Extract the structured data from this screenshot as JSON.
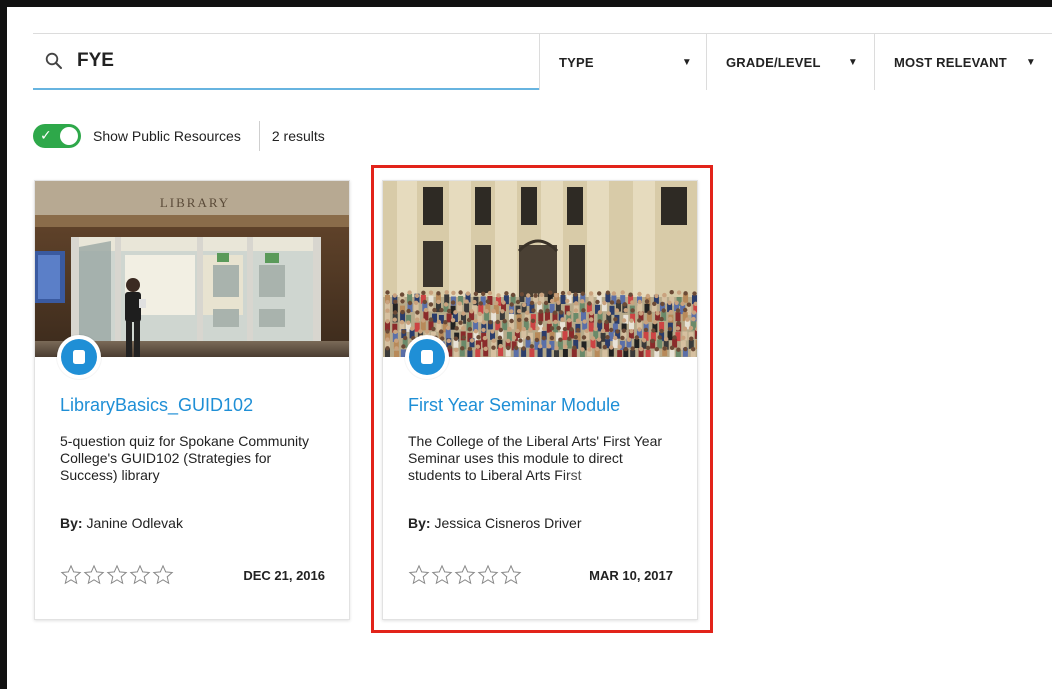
{
  "search": {
    "value": "FYE"
  },
  "filters": {
    "type_label": "TYPE",
    "grade_label": "GRADE/LEVEL",
    "sort_label": "MOST RELEVANT"
  },
  "toggle": {
    "label": "Show Public Resources",
    "on": true
  },
  "results_count": "2 results",
  "cards": [
    {
      "image_sign": "LIBRARY",
      "title": "LibraryBasics_GUID102",
      "description": "5-question quiz for Spokane Community College's GUID102 (Strategies for Success) library",
      "author_prefix": "By:",
      "author": "Janine Odlevak",
      "date": "DEC 21, 2016",
      "rating": 0
    },
    {
      "title": "First Year Seminar Module",
      "description": "The College of the Liberal Arts' First Year Seminar uses this module to direct students to Liberal Arts First",
      "author_prefix": "By:",
      "author": "Jessica Cisneros Driver",
      "date": "MAR 10, 2017",
      "rating": 0
    }
  ],
  "colors": {
    "accent": "#1f8fd6",
    "toggle_on": "#2ea84a",
    "highlight": "#e2231a",
    "search_underline": "#67b4e0"
  },
  "icons": {
    "search": "search-icon",
    "caret": "caret-down-icon",
    "resource": "document-icon",
    "star": "star-outline-icon"
  }
}
